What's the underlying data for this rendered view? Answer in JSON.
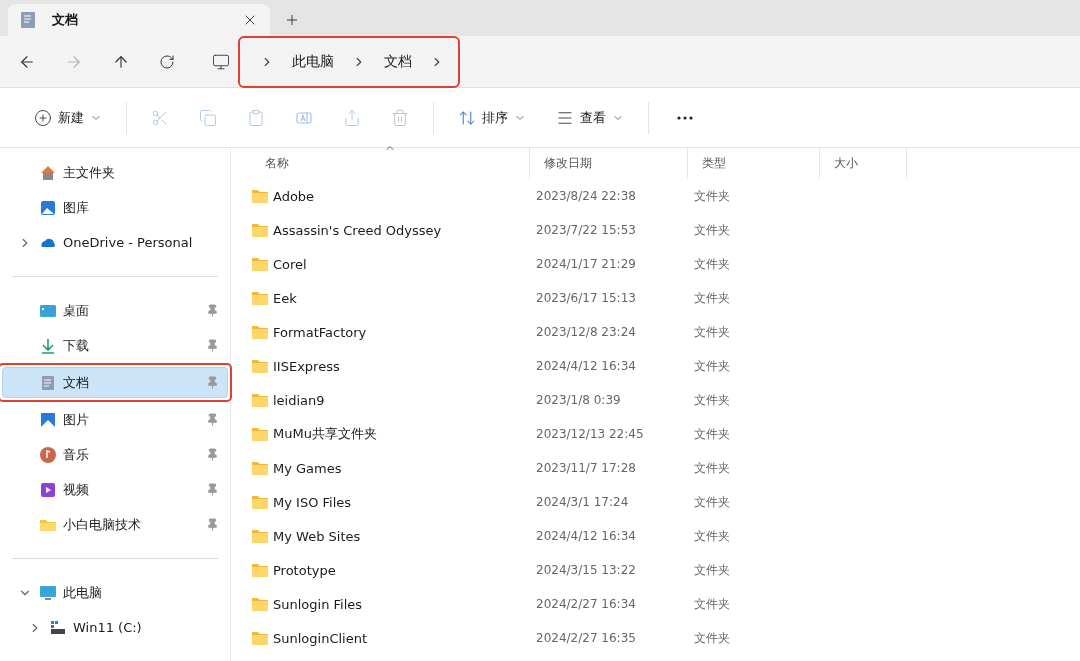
{
  "window": {
    "tab": {
      "title": "文档"
    }
  },
  "nav": {
    "buttons": [
      {
        "kind": "back",
        "disabled": false
      },
      {
        "kind": "forward",
        "disabled": true
      },
      {
        "kind": "up",
        "disabled": false
      },
      {
        "kind": "refresh",
        "disabled": false
      }
    ],
    "breadcrumb": {
      "highlighted": true,
      "items": [
        "此电脑",
        "文档"
      ]
    }
  },
  "toolbar": [
    {
      "kind": "new",
      "label": "新建",
      "disabled": false
    },
    {
      "kind": "separator"
    },
    {
      "kind": "cut",
      "disabled": true
    },
    {
      "kind": "copy",
      "disabled": true
    },
    {
      "kind": "paste",
      "disabled": true
    },
    {
      "kind": "rename",
      "disabled": true
    },
    {
      "kind": "share",
      "disabled": true
    },
    {
      "kind": "delete",
      "disabled": true
    },
    {
      "kind": "separator"
    },
    {
      "kind": "sort",
      "label": "排序",
      "disabled": false
    },
    {
      "kind": "view",
      "label": "查看",
      "disabled": false
    },
    {
      "kind": "separator"
    },
    {
      "kind": "more"
    }
  ],
  "sidebar": {
    "groups": [
      [
        {
          "kind": "home",
          "label": "主文件夹",
          "pinned": false,
          "selected": false,
          "highlighted": false
        },
        {
          "kind": "gallery",
          "label": "图库",
          "pinned": false,
          "selected": false,
          "highlighted": false
        },
        {
          "kind": "cloud",
          "label": "OneDrive - Personal",
          "pinned": false,
          "selected": false,
          "highlighted": false,
          "expanded": false
        }
      ],
      [
        {
          "kind": "desktop",
          "label": "桌面",
          "pinned": true,
          "selected": false,
          "highlighted": false
        },
        {
          "kind": "download",
          "label": "下载",
          "pinned": true,
          "selected": false,
          "highlighted": false
        },
        {
          "kind": "documents",
          "label": "文档",
          "pinned": true,
          "selected": true,
          "highlighted": true
        },
        {
          "kind": "pictures",
          "label": "图片",
          "pinned": true,
          "selected": false,
          "highlighted": false
        },
        {
          "kind": "music",
          "label": "音乐",
          "pinned": true,
          "selected": false,
          "highlighted": false
        },
        {
          "kind": "videos",
          "label": "视频",
          "pinned": true,
          "selected": false,
          "highlighted": false
        },
        {
          "kind": "folder",
          "label": "小白电脑技术",
          "pinned": true,
          "selected": false,
          "highlighted": false
        }
      ],
      [
        {
          "kind": "pc",
          "label": "此电脑",
          "pinned": false,
          "selected": false,
          "highlighted": false,
          "expanded": true,
          "children": [
            {
              "kind": "drive",
              "label": "Win11 (C:)",
              "pinned": false,
              "selected": false,
              "highlighted": false,
              "expanded": false
            }
          ]
        }
      ]
    ]
  },
  "table": {
    "columns": [
      {
        "label": "名称",
        "sorted": true
      },
      {
        "label": "修改日期",
        "sorted": false
      },
      {
        "label": "类型",
        "sorted": false
      },
      {
        "label": "大小",
        "sorted": false
      }
    ],
    "rows": [
      {
        "name": "Adobe",
        "date": "2023/8/24 22:38",
        "type": "文件夹"
      },
      {
        "name": "Assassin's Creed Odyssey",
        "date": "2023/7/22 15:53",
        "type": "文件夹"
      },
      {
        "name": "Corel",
        "date": "2024/1/17 21:29",
        "type": "文件夹"
      },
      {
        "name": "Eek",
        "date": "2023/6/17 15:13",
        "type": "文件夹"
      },
      {
        "name": "FormatFactory",
        "date": "2023/12/8 23:24",
        "type": "文件夹"
      },
      {
        "name": "IISExpress",
        "date": "2024/4/12 16:34",
        "type": "文件夹"
      },
      {
        "name": "leidian9",
        "date": "2023/1/8 0:39",
        "type": "文件夹"
      },
      {
        "name": "MuMu共享文件夹",
        "date": "2023/12/13 22:45",
        "type": "文件夹"
      },
      {
        "name": "My Games",
        "date": "2023/11/7 17:28",
        "type": "文件夹"
      },
      {
        "name": "My ISO Files",
        "date": "2024/3/1 17:24",
        "type": "文件夹"
      },
      {
        "name": "My Web Sites",
        "date": "2024/4/12 16:34",
        "type": "文件夹"
      },
      {
        "name": "Prototype",
        "date": "2024/3/15 13:22",
        "type": "文件夹"
      },
      {
        "name": "Sunlogin Files",
        "date": "2024/2/27 16:34",
        "type": "文件夹"
      },
      {
        "name": "SunloginClient",
        "date": "2024/2/27 16:35",
        "type": "文件夹"
      }
    ]
  }
}
